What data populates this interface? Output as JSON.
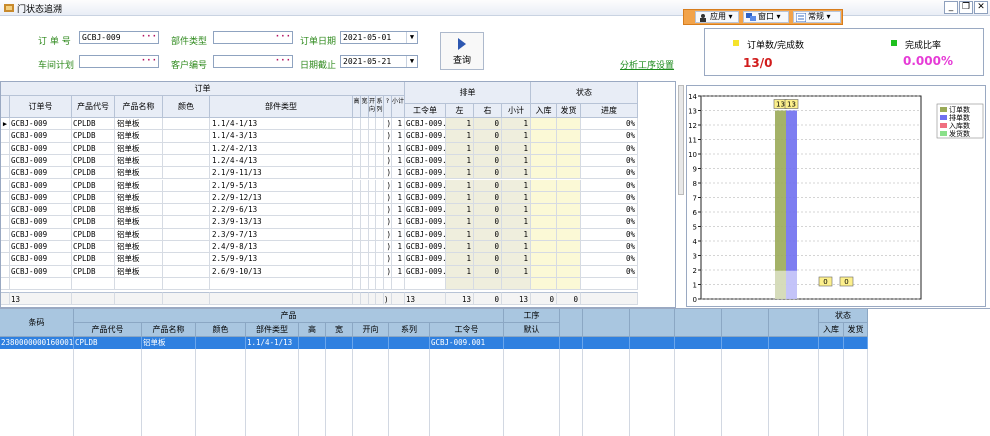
{
  "window": {
    "title": "门状态追溯"
  },
  "toolbar": {
    "app_label": "应用",
    "window_label": "窗口",
    "normal_label": "常规"
  },
  "filters": {
    "order_no_label": "订 单 号",
    "order_no_value": "GCBJ-009",
    "part_type_label": "部件类型",
    "part_type_value": "",
    "order_date_label": "订单日期",
    "order_date_value": "2021-05-01",
    "workshop_plan_label": "车间计划",
    "workshop_plan_value": "",
    "customer_no_label": "客户编号",
    "customer_no_value": "",
    "end_date_label": "日期截止",
    "end_date_value": "2021-05-21",
    "query_label": "查询",
    "analysis_link": "分析工序设置"
  },
  "stats": {
    "order_done_label": "订单数/完成数",
    "order_done_value": "13/0",
    "ratio_label": "完成比率",
    "ratio_value": "0.000%",
    "yellow": "#f5e32c",
    "green": "#1fc01f",
    "red": "#d11c1c",
    "magenta": "#e63bd6"
  },
  "grid1": {
    "group_order": "订单",
    "group_schedule": "排单",
    "group_status": "状态",
    "headers": {
      "order_no": "订单号",
      "product_code": "产品代号",
      "product_name": "产品名称",
      "color": "颜色",
      "part_type": "部件类型",
      "h1": "高",
      "h2": "宽",
      "h3": "开向",
      "h4": "系列",
      "h5": "?",
      "h6": "小计",
      "work_order": "工令单",
      "left": "左",
      "right": "右",
      "subtotal": "小计",
      "stock_in": "入库",
      "ship": "发货",
      "progress": "进度"
    },
    "rows": [
      {
        "order_no": "GCBJ-009",
        "code": "CPLDB",
        "name": "铝单板",
        "part": "1.1/4-1/13",
        "q": "1",
        "wo": "GCBJ-009.",
        "left": "1",
        "right": "0",
        "sub": "1",
        "prog": "0%"
      },
      {
        "order_no": "GCBJ-009",
        "code": "CPLDB",
        "name": "铝单板",
        "part": "1.1/4-3/13",
        "q": "1",
        "wo": "GCBJ-009.",
        "left": "1",
        "right": "0",
        "sub": "1",
        "prog": "0%"
      },
      {
        "order_no": "GCBJ-009",
        "code": "CPLDB",
        "name": "铝单板",
        "part": "1.2/4-2/13",
        "q": "1",
        "wo": "GCBJ-009.",
        "left": "1",
        "right": "0",
        "sub": "1",
        "prog": "0%"
      },
      {
        "order_no": "GCBJ-009",
        "code": "CPLDB",
        "name": "铝单板",
        "part": "1.2/4-4/13",
        "q": "1",
        "wo": "GCBJ-009.",
        "left": "1",
        "right": "0",
        "sub": "1",
        "prog": "0%"
      },
      {
        "order_no": "GCBJ-009",
        "code": "CPLDB",
        "name": "铝单板",
        "part": "2.1/9-11/13",
        "q": "1",
        "wo": "GCBJ-009.",
        "left": "1",
        "right": "0",
        "sub": "1",
        "prog": "0%"
      },
      {
        "order_no": "GCBJ-009",
        "code": "CPLDB",
        "name": "铝单板",
        "part": "2.1/9-5/13",
        "q": "1",
        "wo": "GCBJ-009.",
        "left": "1",
        "right": "0",
        "sub": "1",
        "prog": "0%"
      },
      {
        "order_no": "GCBJ-009",
        "code": "CPLDB",
        "name": "铝单板",
        "part": "2.2/9-12/13",
        "q": "1",
        "wo": "GCBJ-009.",
        "left": "1",
        "right": "0",
        "sub": "1",
        "prog": "0%"
      },
      {
        "order_no": "GCBJ-009",
        "code": "CPLDB",
        "name": "铝单板",
        "part": "2.2/9-6/13",
        "q": "1",
        "wo": "GCBJ-009.",
        "left": "1",
        "right": "0",
        "sub": "1",
        "prog": "0%"
      },
      {
        "order_no": "GCBJ-009",
        "code": "CPLDB",
        "name": "铝单板",
        "part": "2.3/9-13/13",
        "q": "1",
        "wo": "GCBJ-009.",
        "left": "1",
        "right": "0",
        "sub": "1",
        "prog": "0%"
      },
      {
        "order_no": "GCBJ-009",
        "code": "CPLDB",
        "name": "铝单板",
        "part": "2.3/9-7/13",
        "q": "1",
        "wo": "GCBJ-009.",
        "left": "1",
        "right": "0",
        "sub": "1",
        "prog": "0%"
      },
      {
        "order_no": "GCBJ-009",
        "code": "CPLDB",
        "name": "铝单板",
        "part": "2.4/9-8/13",
        "q": "1",
        "wo": "GCBJ-009.",
        "left": "1",
        "right": "0",
        "sub": "1",
        "prog": "0%"
      },
      {
        "order_no": "GCBJ-009",
        "code": "CPLDB",
        "name": "铝单板",
        "part": "2.5/9-9/13",
        "q": "1",
        "wo": "GCBJ-009.",
        "left": "1",
        "right": "0",
        "sub": "1",
        "prog": "0%"
      },
      {
        "order_no": "GCBJ-009",
        "code": "CPLDB",
        "name": "铝单板",
        "part": "2.6/9-10/13",
        "q": "1",
        "wo": "GCBJ-009.",
        "left": "1",
        "right": "0",
        "sub": "1",
        "prog": "0%"
      }
    ],
    "footer": {
      "count": "13",
      "wo": "13",
      "left": "13",
      "right": "0",
      "sub": "13",
      "in": "0",
      "ship": "0"
    }
  },
  "chart_data": {
    "type": "bar",
    "categories": [
      "订单数",
      "排单数",
      "入库数",
      "发货数"
    ],
    "values": [
      13,
      13,
      0,
      0
    ],
    "ylim": [
      0,
      14
    ],
    "yticks": [
      "0",
      "1",
      "2",
      "3",
      "4",
      "5",
      "6",
      "7",
      "8",
      "9",
      "10",
      "11",
      "12",
      "13",
      "14"
    ],
    "legend": "top-right",
    "grid": true,
    "colors": [
      "#9aaa58",
      "#6f6ff0",
      "#f06f80",
      "#8ae08a"
    ]
  },
  "grid2": {
    "barcode_label": "条码",
    "product_group": "产品",
    "process_group": "工序",
    "status_group": "状态",
    "headers": {
      "code": "产品代号",
      "name": "产品名称",
      "color": "颜色",
      "part": "部件类型",
      "h": "高",
      "w": "宽",
      "open": "开向",
      "series": "系列",
      "wo": "工令号",
      "default": "默认",
      "in": "入库",
      "ship": "发货"
    },
    "row": {
      "barcode": "2380000000160001",
      "code": "CPLDB",
      "name": "铝单板",
      "part": "1.1/4-1/13",
      "wo": "GCBJ-009.001"
    }
  }
}
